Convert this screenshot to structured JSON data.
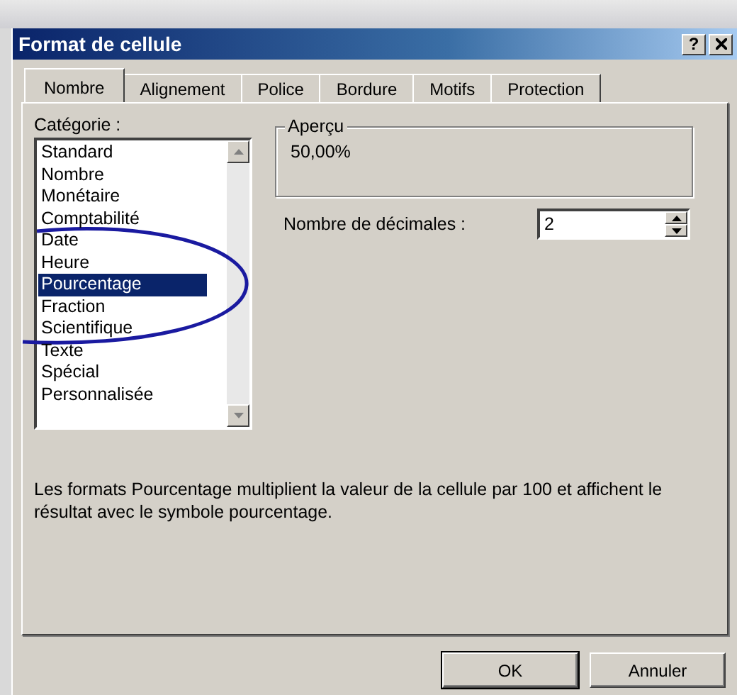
{
  "window": {
    "title": "Format de cellule",
    "help_button": "?"
  },
  "tabs": [
    {
      "label": "Nombre",
      "selected": true
    },
    {
      "label": "Alignement",
      "selected": false
    },
    {
      "label": "Police",
      "selected": false
    },
    {
      "label": "Bordure",
      "selected": false
    },
    {
      "label": "Motifs",
      "selected": false
    },
    {
      "label": "Protection",
      "selected": false
    }
  ],
  "category": {
    "label": "Catégorie :",
    "items": [
      {
        "label": "Standard",
        "selected": false
      },
      {
        "label": "Nombre",
        "selected": false
      },
      {
        "label": "Monétaire",
        "selected": false
      },
      {
        "label": "Comptabilité",
        "selected": false
      },
      {
        "label": "Date",
        "selected": false
      },
      {
        "label": "Heure",
        "selected": false
      },
      {
        "label": "Pourcentage",
        "selected": true
      },
      {
        "label": "Fraction",
        "selected": false
      },
      {
        "label": "Scientifique",
        "selected": false
      },
      {
        "label": "Texte",
        "selected": false
      },
      {
        "label": "Spécial",
        "selected": false
      },
      {
        "label": "Personnalisée",
        "selected": false
      }
    ]
  },
  "preview": {
    "label": "Aperçu",
    "value": "50,00%"
  },
  "decimals": {
    "label": "Nombre de décimales :",
    "value": "2"
  },
  "description": "Les formats Pourcentage multiplient la valeur de la cellule par 100 et affichent le résultat avec le symbole pourcentage.",
  "buttons": [
    "OK",
    "Annuler"
  ]
}
